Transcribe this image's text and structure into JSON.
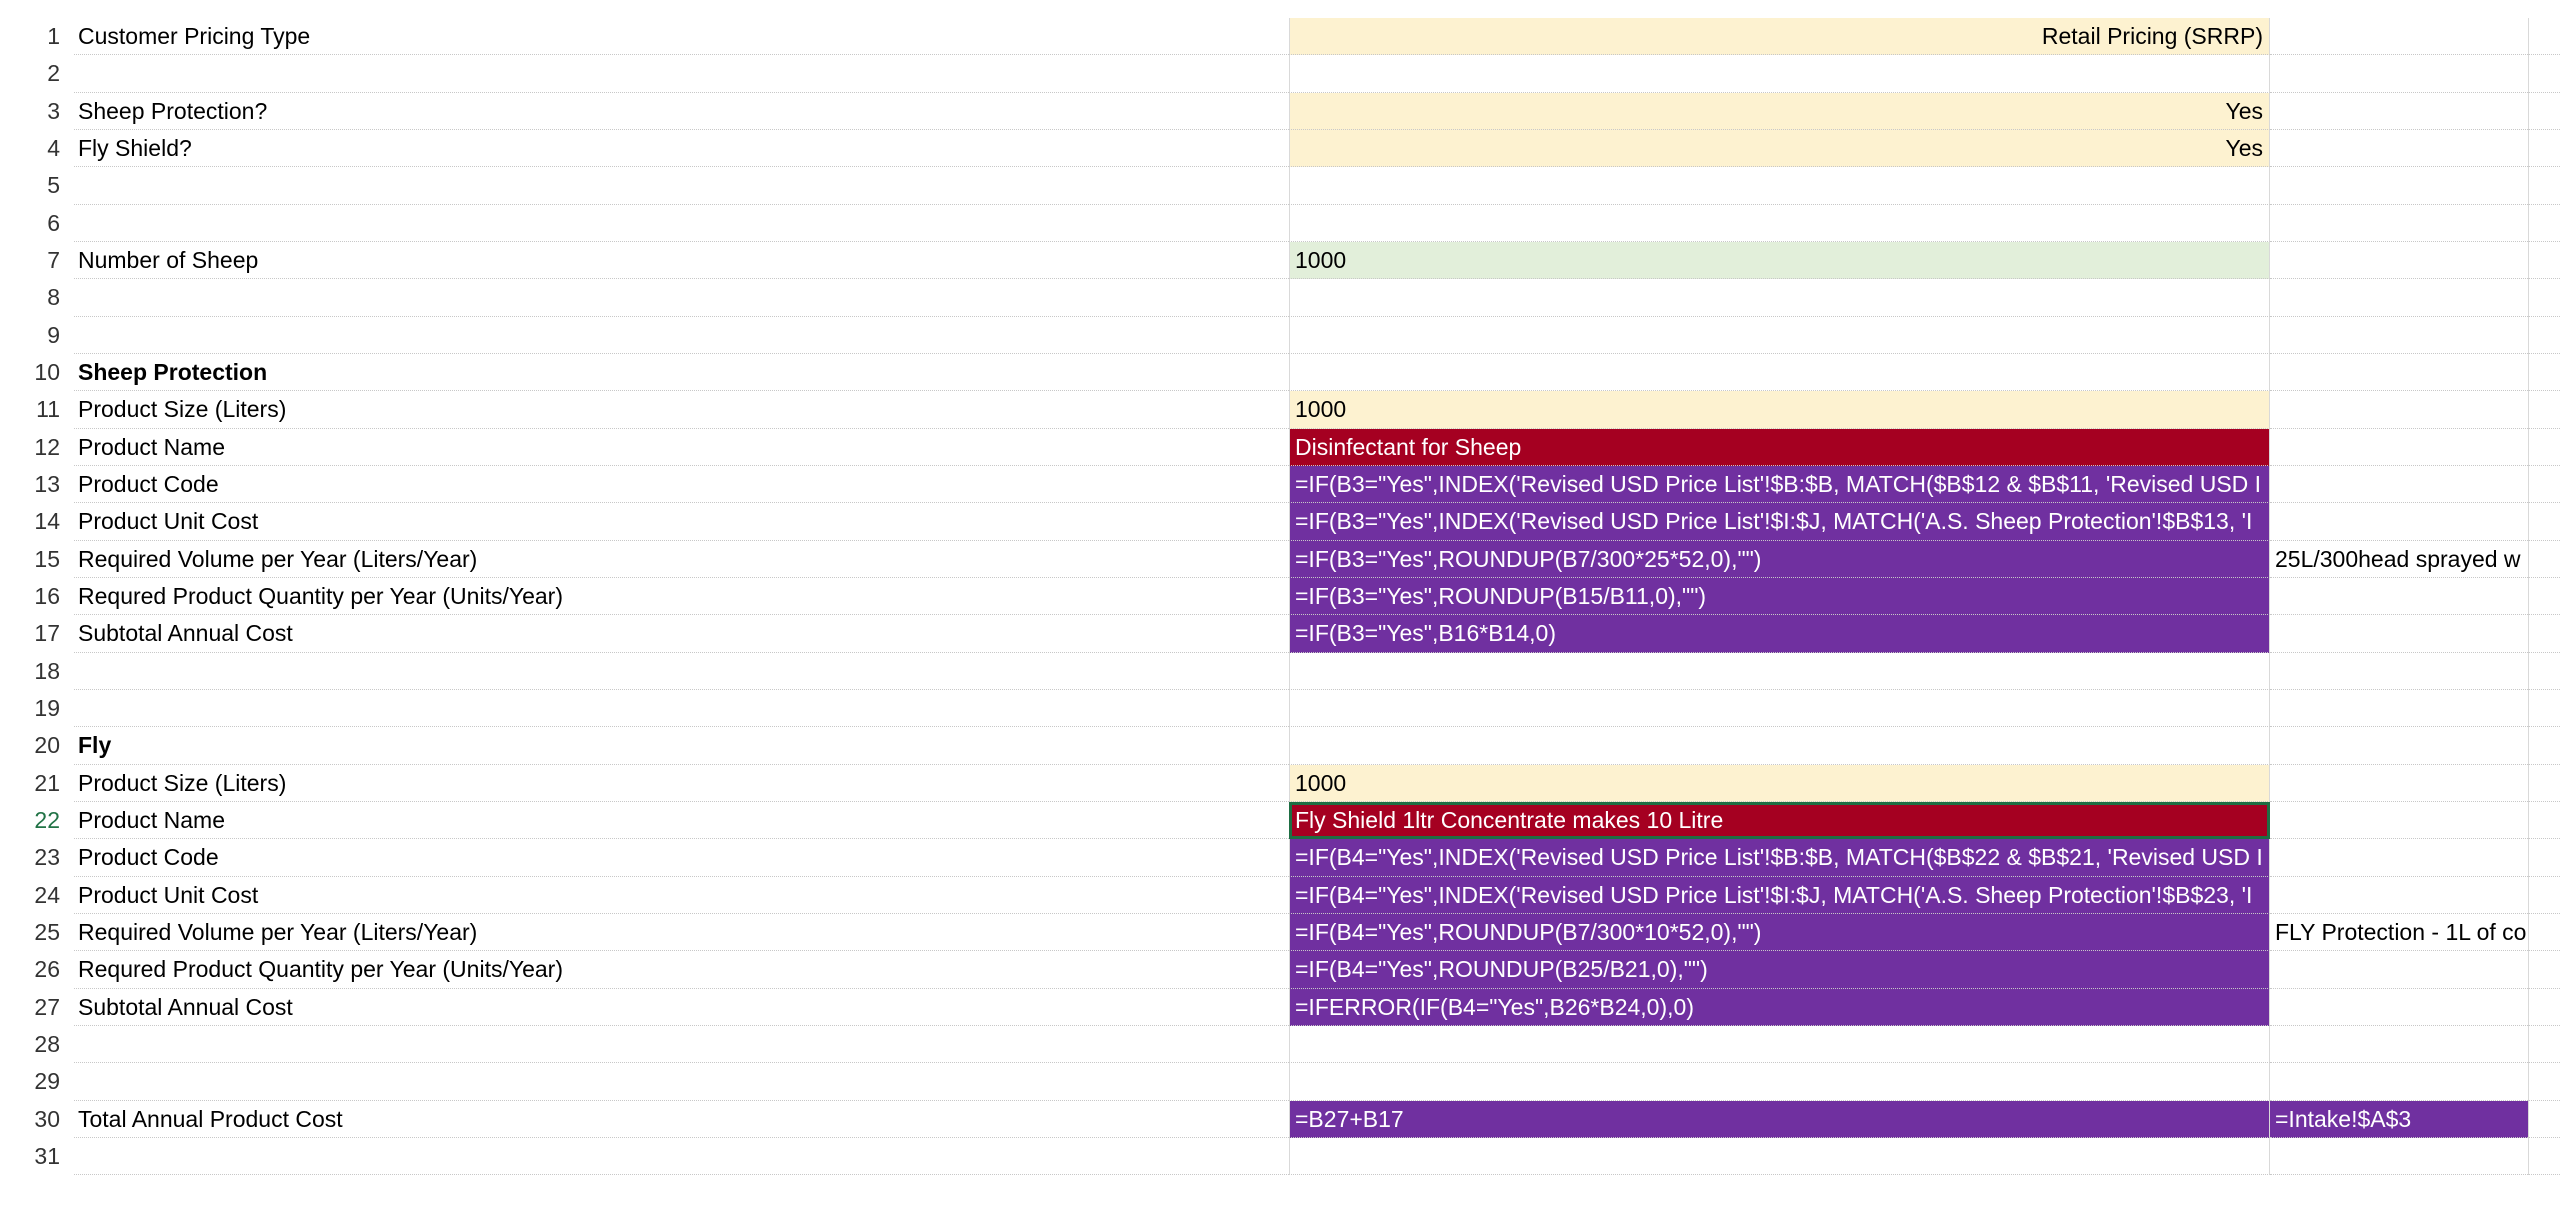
{
  "rows": [
    {
      "num": "1",
      "a": "Customer Pricing Type",
      "b": "Retail Pricing (SRRP)",
      "c": ""
    },
    {
      "num": "2",
      "a": "",
      "b": "",
      "c": ""
    },
    {
      "num": "3",
      "a": "Sheep Protection?",
      "b": "Yes",
      "c": ""
    },
    {
      "num": "4",
      "a": "Fly Shield?",
      "b": "Yes",
      "c": ""
    },
    {
      "num": "5",
      "a": "",
      "b": "",
      "c": ""
    },
    {
      "num": "6",
      "a": "",
      "b": "",
      "c": ""
    },
    {
      "num": "7",
      "a": "Number of Sheep",
      "b": "1000",
      "c": ""
    },
    {
      "num": "8",
      "a": "",
      "b": "",
      "c": ""
    },
    {
      "num": "9",
      "a": "",
      "b": "",
      "c": ""
    },
    {
      "num": "10",
      "a": "Sheep Protection",
      "b": "",
      "c": ""
    },
    {
      "num": "11",
      "a": "Product Size (Liters)",
      "b": "1000",
      "c": ""
    },
    {
      "num": "12",
      "a": "Product Name",
      "b": "Disinfectant for Sheep",
      "c": ""
    },
    {
      "num": "13",
      "a": "Product Code",
      "b": "=IF(B3=\"Yes\",INDEX('Revised USD Price List'!$B:$B, MATCH($B$12 & $B$11, 'Revised USD I",
      "c": ""
    },
    {
      "num": "14",
      "a": "Product Unit Cost",
      "b": "=IF(B3=\"Yes\",INDEX('Revised USD Price List'!$I:$J, MATCH('A.S. Sheep Protection'!$B$13, 'I",
      "c": ""
    },
    {
      "num": "15",
      "a": "Required Volume per Year (Liters/Year)",
      "b": "=IF(B3=\"Yes\",ROUNDUP(B7/300*25*52,0),\"\")",
      "c": "25L/300head sprayed w"
    },
    {
      "num": "16",
      "a": "Requred Product Quantity per Year (Units/Year)",
      "b": "=IF(B3=\"Yes\",ROUNDUP(B15/B11,0),\"\")",
      "c": ""
    },
    {
      "num": "17",
      "a": "Subtotal Annual Cost",
      "b": "=IF(B3=\"Yes\",B16*B14,0)",
      "c": ""
    },
    {
      "num": "18",
      "a": "",
      "b": "",
      "c": ""
    },
    {
      "num": "19",
      "a": "",
      "b": "",
      "c": ""
    },
    {
      "num": "20",
      "a": "Fly",
      "b": "",
      "c": ""
    },
    {
      "num": "21",
      "a": "Product Size (Liters)",
      "b": "1000",
      "c": ""
    },
    {
      "num": "22",
      "a": "Product Name",
      "b": "Fly Shield 1ltr Concentrate makes 10 Litre",
      "c": ""
    },
    {
      "num": "23",
      "a": "Product Code",
      "b": "=IF(B4=\"Yes\",INDEX('Revised USD Price List'!$B:$B, MATCH($B$22 & $B$21, 'Revised USD I",
      "c": ""
    },
    {
      "num": "24",
      "a": "Product Unit Cost",
      "b": "=IF(B4=\"Yes\",INDEX('Revised USD Price List'!$I:$J, MATCH('A.S. Sheep Protection'!$B$23, 'I",
      "c": ""
    },
    {
      "num": "25",
      "a": "Required Volume per Year (Liters/Year)",
      "b": "=IF(B4=\"Yes\",ROUNDUP(B7/300*10*52,0),\"\")",
      "c": "FLY Protection - 1L of co"
    },
    {
      "num": "26",
      "a": "Requred Product Quantity per Year (Units/Year)",
      "b": "=IF(B4=\"Yes\",ROUNDUP(B25/B21,0),\"\")",
      "c": ""
    },
    {
      "num": "27",
      "a": "Subtotal Annual Cost",
      "b": "=IFERROR(IF(B4=\"Yes\",B26*B24,0),0)",
      "c": ""
    },
    {
      "num": "28",
      "a": "",
      "b": "",
      "c": ""
    },
    {
      "num": "29",
      "a": "",
      "b": "",
      "c": ""
    },
    {
      "num": "30",
      "a": "Total Annual Product Cost",
      "b": "=B27+B17",
      "c": "=Intake!$A$3"
    },
    {
      "num": "31",
      "a": "",
      "b": "",
      "c": ""
    }
  ],
  "colors": {
    "input_yellow": "#fdf2d0",
    "input_green": "#e2efda",
    "name_red": "#a50021",
    "formula_purple": "#7030a0",
    "selection_green": "#1e6e43"
  }
}
